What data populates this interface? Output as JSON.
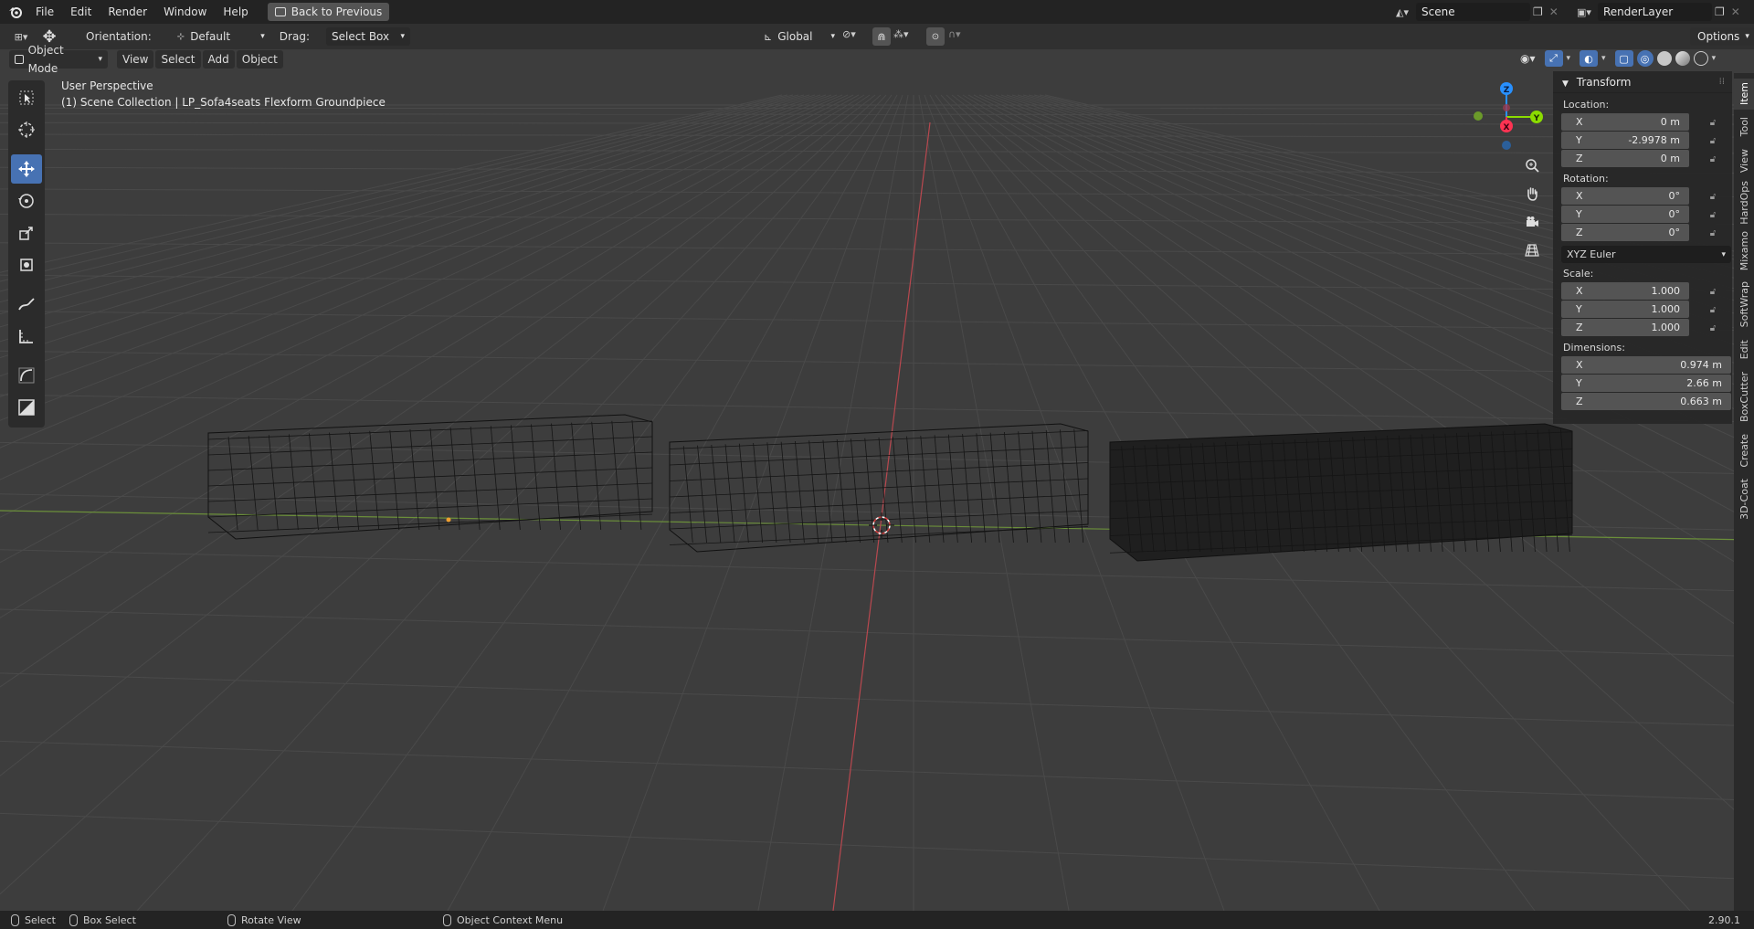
{
  "topbar": {
    "menus": [
      "File",
      "Edit",
      "Render",
      "Window",
      "Help"
    ],
    "back_button": "Back to Previous",
    "scene_value": "Scene",
    "render_layer_value": "RenderLayer"
  },
  "header": {
    "orientation_label": "Orientation:",
    "orientation_value": "Default",
    "drag_label": "Drag:",
    "drag_value": "Select Box",
    "transform_orientation": "Global",
    "options_label": "Options"
  },
  "viewport_header": {
    "mode": "Object Mode",
    "menus": [
      "View",
      "Select",
      "Add",
      "Object"
    ]
  },
  "overlay": {
    "view_name": "User Perspective",
    "collection_info": "(1) Scene Collection | LP_Sofa4seats Flexform Groundpiece"
  },
  "gizmo": {
    "x_label": "X",
    "y_label": "Y",
    "z_label": "Z"
  },
  "colors": {
    "x_axis": "#ff3352",
    "y_axis": "#8bdc00",
    "z_axis": "#2890ff",
    "active_tool": "#4772b3"
  },
  "npanel": {
    "title": "Transform",
    "location_label": "Location:",
    "location": [
      {
        "axis": "X",
        "value": "0 m"
      },
      {
        "axis": "Y",
        "value": "-2.9978 m"
      },
      {
        "axis": "Z",
        "value": "0 m"
      }
    ],
    "rotation_label": "Rotation:",
    "rotation": [
      {
        "axis": "X",
        "value": "0°"
      },
      {
        "axis": "Y",
        "value": "0°"
      },
      {
        "axis": "Z",
        "value": "0°"
      }
    ],
    "rotation_mode": "XYZ Euler",
    "scale_label": "Scale:",
    "scale": [
      {
        "axis": "X",
        "value": "1.000"
      },
      {
        "axis": "Y",
        "value": "1.000"
      },
      {
        "axis": "Z",
        "value": "1.000"
      }
    ],
    "dimensions_label": "Dimensions:",
    "dimensions": [
      {
        "axis": "X",
        "value": "0.974 m"
      },
      {
        "axis": "Y",
        "value": "2.66 m"
      },
      {
        "axis": "Z",
        "value": "0.663 m"
      }
    ]
  },
  "side_tabs": [
    "Item",
    "Tool",
    "View",
    "HardOps",
    "Mixamo",
    "SoftWrap",
    "Edit",
    "BoxCutter",
    "Create",
    "3D-Coat"
  ],
  "statusbar": {
    "select": "Select",
    "box_select": "Box Select",
    "rotate_view": "Rotate View",
    "context_menu": "Object Context Menu",
    "version": "2.90.1"
  }
}
